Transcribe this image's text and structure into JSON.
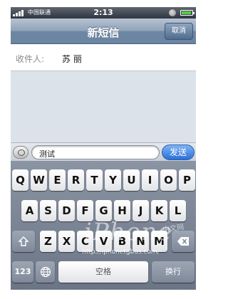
{
  "status_bar": {
    "carrier": "中国联通",
    "time": "2:13"
  },
  "nav": {
    "title": "新短信",
    "cancel_label": "取消"
  },
  "recipient": {
    "label": "收件人:",
    "name": "苏 丽"
  },
  "compose": {
    "text_value": "测试",
    "send_label": "发送"
  },
  "keyboard": {
    "row1": [
      "Q",
      "W",
      "E",
      "R",
      "T",
      "Y",
      "U",
      "I",
      "O",
      "P"
    ],
    "row2": [
      "A",
      "S",
      "D",
      "F",
      "G",
      "H",
      "J",
      "K",
      "L"
    ],
    "row3": [
      "Z",
      "X",
      "C",
      "V",
      "B",
      "N",
      "M"
    ],
    "numbers_label": "123",
    "space_label": "空格",
    "return_label": "换行"
  },
  "watermark": {
    "logo": "iPhone",
    "sub": "中文网",
    "url": "http://iphonetgbus.com/"
  },
  "icons": [
    "signal-bars-icon",
    "lock-icon",
    "battery-icon",
    "camera-icon",
    "shift-icon",
    "delete-icon",
    "globe-icon"
  ]
}
